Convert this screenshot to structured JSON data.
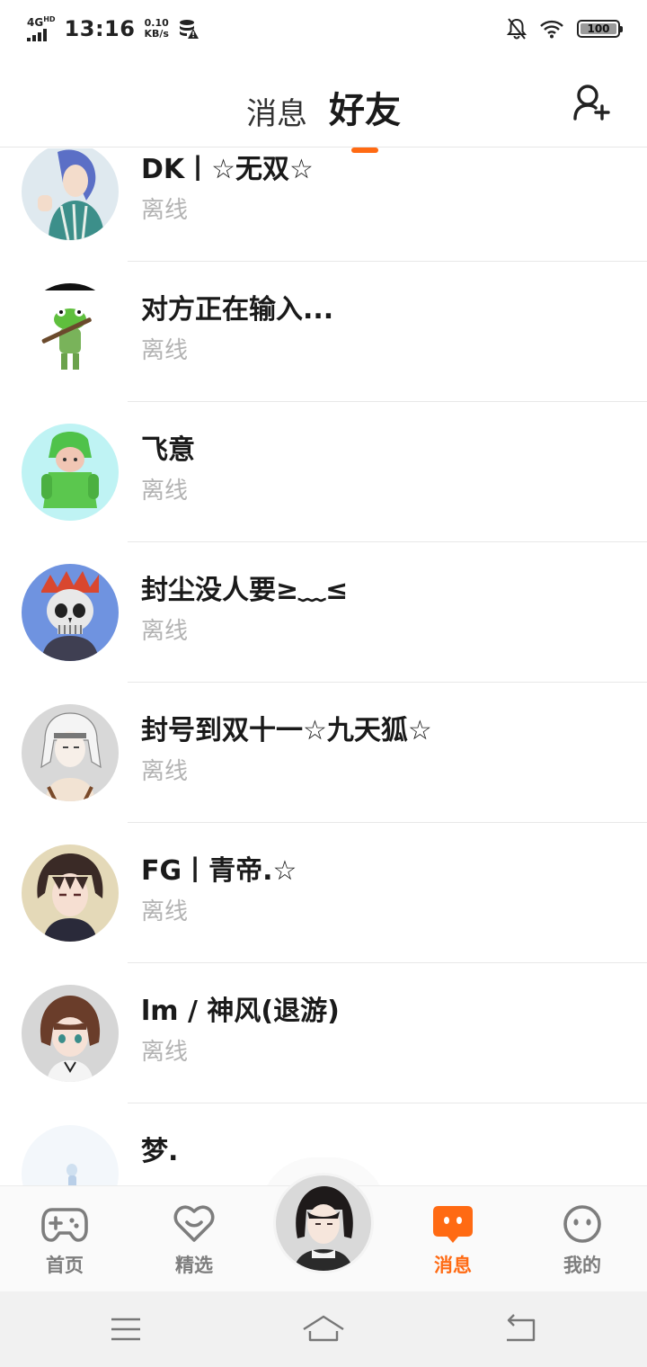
{
  "status_bar": {
    "network": "4G",
    "network_suffix": "HD",
    "time": "13:16",
    "speed_value": "0.10",
    "speed_unit": "KB/s",
    "battery": "100",
    "battery_level": 1.0
  },
  "header": {
    "tabs": [
      {
        "label": "消息",
        "active": false
      },
      {
        "label": "好友",
        "active": true
      }
    ],
    "accent_color": "#ff6a13",
    "add_friend_icon": "add-user-icon"
  },
  "friends": [
    {
      "name": "DK丨☆无双☆",
      "status": "离线"
    },
    {
      "name": "对方正在输入...",
      "status": "离线"
    },
    {
      "name": "飞意",
      "status": "离线"
    },
    {
      "name": "封尘没人要≥﹏≤",
      "status": "离线"
    },
    {
      "name": "封号到双十一☆九天狐☆",
      "status": "离线"
    },
    {
      "name": "FG丨青帝.☆",
      "status": "离线"
    },
    {
      "name": "lm / 神风(退游)",
      "status": "离线"
    },
    {
      "name": "梦.",
      "status": ""
    }
  ],
  "bottom_nav": {
    "items": [
      {
        "label": "首页",
        "icon": "gamepad-icon",
        "active": false
      },
      {
        "label": "精选",
        "icon": "heart-icon",
        "active": false
      },
      {
        "label": "消息",
        "icon": "message-icon",
        "active": true
      },
      {
        "label": "我的",
        "icon": "face-icon",
        "active": false
      }
    ],
    "center_icon": "profile-avatar"
  },
  "system_nav": {
    "icons": [
      "menu-icon",
      "home-icon",
      "back-icon"
    ]
  }
}
